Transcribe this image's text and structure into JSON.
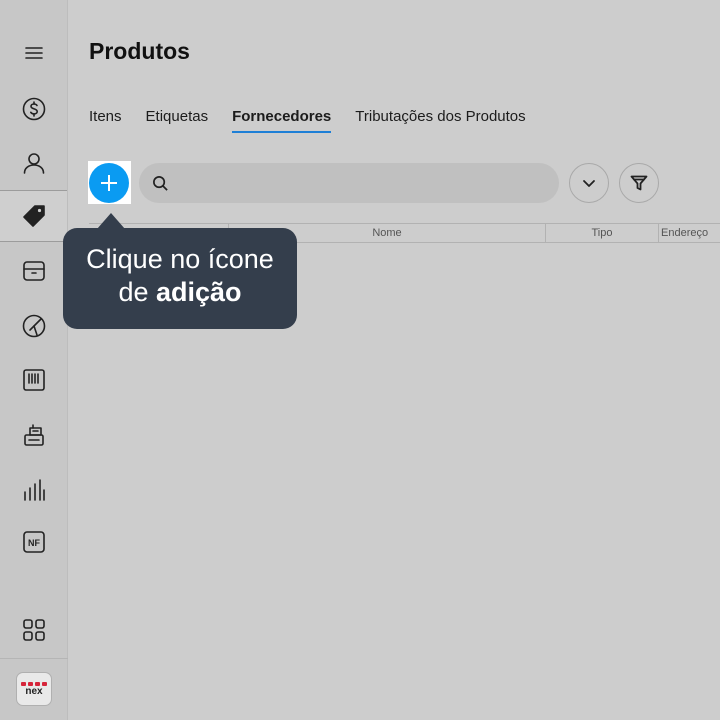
{
  "sidebar": {
    "items": [
      {
        "icon": "menu-icon"
      },
      {
        "icon": "dollar-coin-icon"
      },
      {
        "icon": "user-icon"
      },
      {
        "icon": "tag-icon",
        "active": true
      },
      {
        "icon": "register-icon"
      },
      {
        "icon": "chart-pie-icon"
      },
      {
        "icon": "barcode-icon"
      },
      {
        "icon": "printer-icon"
      },
      {
        "icon": "bar-chart-icon"
      },
      {
        "icon": "nf-icon",
        "label": "NF"
      },
      {
        "icon": "apps-grid-icon"
      }
    ],
    "logo_text": "nex"
  },
  "header": {
    "title": "Produtos"
  },
  "tabs": [
    {
      "label": "Itens",
      "active": false
    },
    {
      "label": "Etiquetas",
      "active": false
    },
    {
      "label": "Fornecedores",
      "active": true
    },
    {
      "label": "Tributações dos Produtos",
      "active": false
    }
  ],
  "search": {
    "value": "",
    "placeholder": ""
  },
  "table": {
    "columns": [
      "Nome",
      "Tipo",
      "Endereço"
    ]
  },
  "tooltip": {
    "line1": "Clique no ícone",
    "line2_prefix": "de",
    "line2_bold": "adição"
  },
  "colors": {
    "accent": "#0a9bf2",
    "tab_underline": "#1e7fd6",
    "tooltip_bg": "#343e4c",
    "logo_red": "#d6253a"
  }
}
